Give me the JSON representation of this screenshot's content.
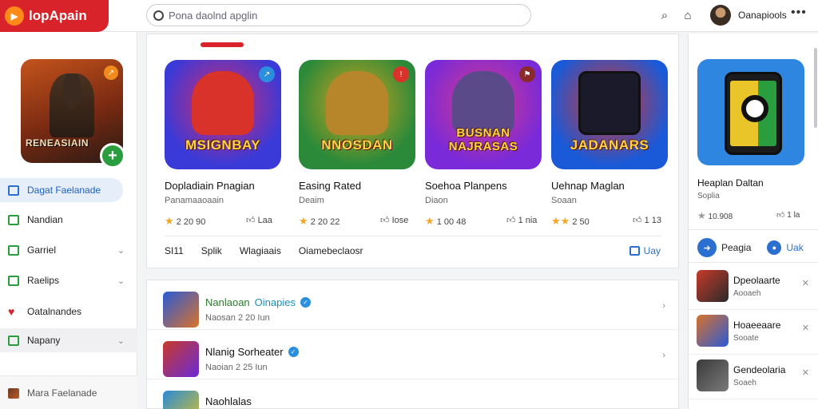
{
  "app": {
    "name": "lopApain",
    "accent": "#d8232a"
  },
  "search": {
    "placeholder": "Pona daolnd apglin"
  },
  "header": {
    "username": "Oanapiools",
    "more": "•••"
  },
  "sidebar": {
    "featured": {
      "art_title": "RENEASIAIN",
      "pin_icon": "arrow-icon",
      "add": "+"
    },
    "items": [
      {
        "label": "Dagat Faelanade",
        "icon": "grid-icon",
        "active": true
      },
      {
        "label": "Nandian",
        "icon": "grid-icon"
      },
      {
        "label": "Garriel",
        "icon": "grid-icon",
        "chevron": "⌄"
      },
      {
        "label": "Raelips",
        "icon": "grid-icon",
        "chevron": "⌄"
      },
      {
        "label": "Oatalnandes",
        "icon": "heart-icon"
      },
      {
        "label": "Napany",
        "icon": "grid-icon",
        "chevron": "⌄"
      }
    ],
    "bottom_item": {
      "label": "Mara Faelanade"
    }
  },
  "featured_games": [
    {
      "art_title": "MSIGNBAY",
      "name": "Dopladiain Pnagian",
      "sub": "Panamaaoaain",
      "rating": "2 20 90",
      "likes": "Laa",
      "colors": [
        "#3a3ad8",
        "#d82a6a"
      ]
    },
    {
      "art_title": "NNOSDAN",
      "name": "Easing Rated",
      "sub": "Deaim",
      "rating": "2 20 22",
      "likes": "Iose",
      "colors": [
        "#2a8a3a",
        "#d8a21a"
      ]
    },
    {
      "art_title": "BUSNAN NAJRASAS",
      "name": "Soehoa Planpens",
      "sub": "Diaon",
      "rating": "1 00 48",
      "likes": "1 nia",
      "colors": [
        "#7a2ad8",
        "#d83a8a"
      ]
    },
    {
      "art_title": "JADANARS",
      "name": "Uehnap Maglan",
      "sub": "Soaan",
      "rating": "2 50",
      "likes": "1 13",
      "colors": [
        "#1a5ad8",
        "#d8322a"
      ]
    }
  ],
  "tabs": [
    "SI11",
    "Splik",
    "Wlagiaais",
    "Oiamebeclaosr"
  ],
  "more_link": "Uay",
  "list": [
    {
      "title_a": "Nanlaoan",
      "title_b": "Oinapies",
      "meta": "Naosan 2 20 Iun",
      "verified": "✓",
      "colors": [
        "#2a5ad8",
        "#d8722a"
      ]
    },
    {
      "title_a": "Nlanig Sorheater",
      "title_b": "",
      "meta": "Naoian 2 25 Iun",
      "verified": "✓",
      "colors": [
        "#c83a2a",
        "#6a2ad8"
      ]
    },
    {
      "title_a": "Naohlalas",
      "title_b": "",
      "meta": "",
      "verified": "",
      "colors": [
        "#2a8ad8",
        "#d8c22a"
      ]
    }
  ],
  "right_panel": {
    "name": "Heaplan Daltan",
    "sub": "Soplia",
    "rating": "10.908",
    "likes": "1 la",
    "action_1": "Peagia",
    "action_2": "Uak",
    "items": [
      {
        "title": "Dpeolaarte",
        "meta": "Aooaeh",
        "colors": [
          "#c83a2a",
          "#2a2a2a"
        ]
      },
      {
        "title": "Hoaeeaare",
        "meta": "Sooate",
        "colors": [
          "#d8722a",
          "#2a5ad8"
        ]
      },
      {
        "title": "Gendeolaria",
        "meta": "Soaeh",
        "colors": [
          "#3a3a3a",
          "#7a7a7a"
        ]
      }
    ]
  }
}
